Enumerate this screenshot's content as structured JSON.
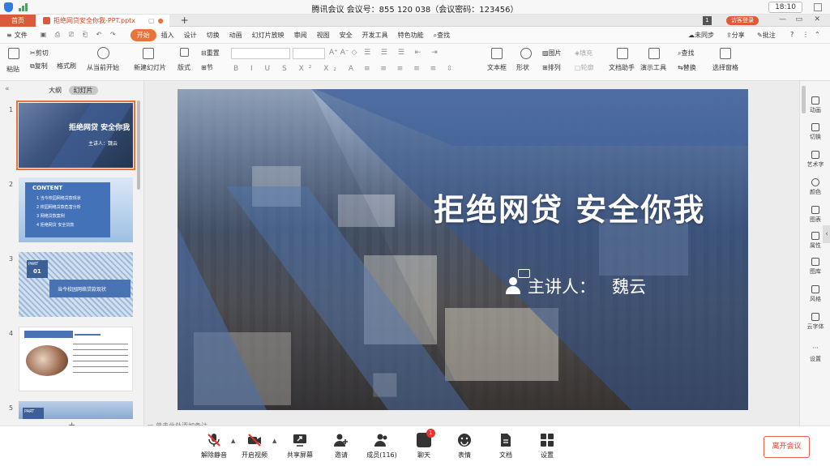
{
  "meeting": {
    "title": "腾讯会议 会议号：855 120 038（会议密码：123456）",
    "clock": "18:10",
    "guest_label": "访客登录"
  },
  "tabs": {
    "home": "首页",
    "document": "拒绝网贷安全你我-PPT.pptx",
    "add": "+"
  },
  "menu": {
    "items": [
      "文件",
      "开始",
      "插入",
      "设计",
      "切换",
      "动画",
      "幻灯片放映",
      "审阅",
      "视图",
      "安全",
      "开发工具",
      "特色功能",
      "查找"
    ],
    "right": [
      "未同步",
      "分享",
      "批注"
    ]
  },
  "ribbon": {
    "paste": "粘贴",
    "cut": "剪切",
    "copy": "复制",
    "format_painter": "格式刷",
    "play_from_current": "从当前开始",
    "new_slide": "新建幻灯片",
    "layout": "版式",
    "reset": "重置",
    "section": "节",
    "textbox": "文本框",
    "shape": "形状",
    "picture": "图片",
    "arrange": "排列",
    "fill": "填充",
    "outline": "轮廓",
    "doc_assistant": "文档助手",
    "present_tools": "演示工具",
    "find": "查找",
    "replace": "替换",
    "select_pane": "选择窗格",
    "text_effect": "文件"
  },
  "left_panel": {
    "tab_outline": "大纲",
    "tab_slides": "幻灯片",
    "slides": [
      {
        "num": "1",
        "title": "拒绝网贷 安全你我",
        "sub": "主讲人：魏云"
      },
      {
        "num": "2",
        "title": "CONTENT",
        "items": [
          "1  当今校园网络贷款现状",
          "2  校园网络贷款危害分析",
          "3  网络贷款案例",
          "4  拒绝网贷 安全贷款"
        ]
      },
      {
        "num": "3",
        "part": "PART",
        "part_no": "01",
        "title": "当今校园网络贷款现状"
      },
      {
        "num": "4"
      },
      {
        "num": "5",
        "part": "PART"
      }
    ]
  },
  "slide": {
    "title": "拒绝网贷 安全你我",
    "speaker_label": "主讲人：",
    "speaker_name": "魏云"
  },
  "notes_placeholder": "单击此处添加备注",
  "right_bar": [
    "动画",
    "切换",
    "艺术字",
    "颜色",
    "图表",
    "属性",
    "图库",
    "风格",
    "云字体",
    "设置"
  ],
  "bottom": {
    "buttons": [
      "解除静音",
      "开启视频",
      "共享屏幕",
      "邀请",
      "成员(116)",
      "聊天",
      "表情",
      "文档",
      "设置"
    ],
    "chat_badge": "1",
    "leave": "离开会议"
  },
  "colors": {
    "accent": "#e8743b",
    "tab_home": "#d95b38",
    "leave": "#e0452b",
    "badge": "#e8322b"
  }
}
